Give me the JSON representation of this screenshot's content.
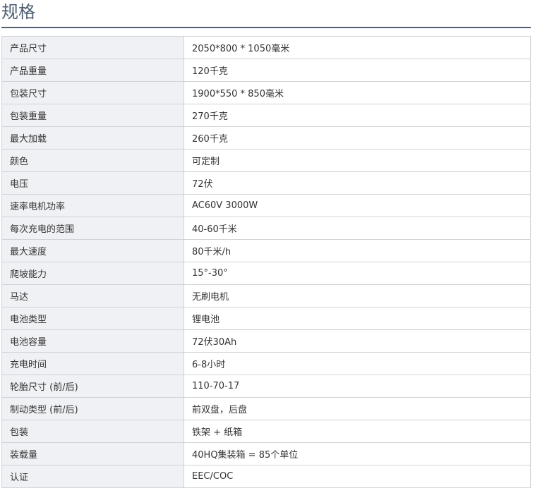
{
  "title": "规格",
  "specs": [
    {
      "label": "产品尺寸",
      "value": "2050*800 * 1050毫米"
    },
    {
      "label": "产品重量",
      "value": "120千克"
    },
    {
      "label": "包装尺寸",
      "value": "1900*550 * 850毫米"
    },
    {
      "label": "包装重量",
      "value": "270千克"
    },
    {
      "label": "最大加载",
      "value": "260千克"
    },
    {
      "label": "颜色",
      "value": "可定制"
    },
    {
      "label": "电压",
      "value": "72伏"
    },
    {
      "label": "速率电机功率",
      "value": "AC60V 3000W"
    },
    {
      "label": "每次充电的范围",
      "value": "40-60千米"
    },
    {
      "label": "最大速度",
      "value": "80千米/h"
    },
    {
      "label": "爬坡能力",
      "value": "15°-30°"
    },
    {
      "label": "马达",
      "value": "无刷电机"
    },
    {
      "label": "电池类型",
      "value": "锂电池"
    },
    {
      "label": "电池容量",
      "value": "72伏30Ah"
    },
    {
      "label": "充电时间",
      "value": "6-8小时"
    },
    {
      "label": "轮胎尺寸 (前/后)",
      "value": "110-70-17"
    },
    {
      "label": "制动类型 (前/后)",
      "value": "前双盘，后盘"
    },
    {
      "label": "包装",
      "value": "铁架 + 纸箱"
    },
    {
      "label": "装载量",
      "value": "40HQ集装箱 = 85个单位"
    },
    {
      "label": "认证",
      "value": "EEC/COC"
    }
  ]
}
